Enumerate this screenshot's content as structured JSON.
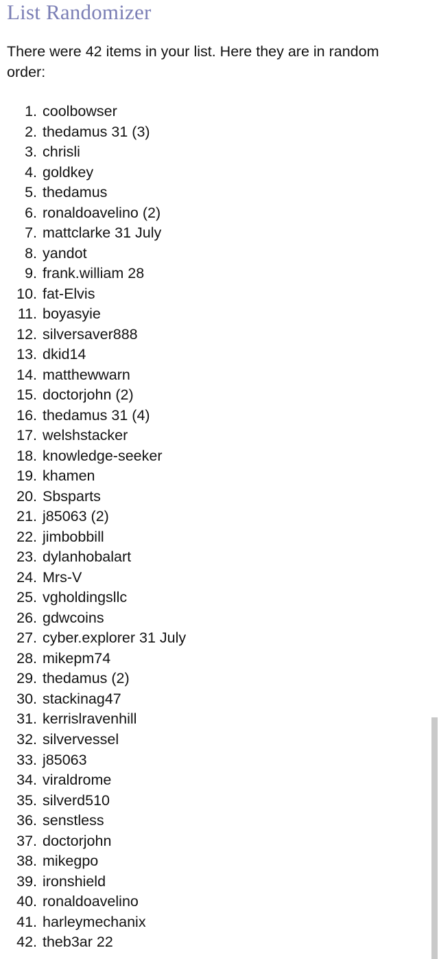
{
  "page": {
    "title": "List Randomizer",
    "intro": "There were 42 items in your list. Here they are in random order:",
    "item_count": 42,
    "background_color": "#ffffff",
    "title_color": "#7b7fb5",
    "text_color": "#111111"
  },
  "list": {
    "items": [
      {
        "index": "1.",
        "label": "coolbowser"
      },
      {
        "index": "2.",
        "label": "thedamus 31 (3)"
      },
      {
        "index": "3.",
        "label": "chrisli"
      },
      {
        "index": "4.",
        "label": "goldkey"
      },
      {
        "index": "5.",
        "label": "thedamus"
      },
      {
        "index": "6.",
        "label": "ronaldoavelino (2)"
      },
      {
        "index": "7.",
        "label": "mattclarke 31 July"
      },
      {
        "index": "8.",
        "label": "yandot"
      },
      {
        "index": "9.",
        "label": "frank.william 28"
      },
      {
        "index": "10.",
        "label": "fat-Elvis"
      },
      {
        "index": "11.",
        "label": "boyasyie"
      },
      {
        "index": "12.",
        "label": "silversaver888"
      },
      {
        "index": "13.",
        "label": "dkid14"
      },
      {
        "index": "14.",
        "label": "matthewwarn"
      },
      {
        "index": "15.",
        "label": "doctorjohn (2)"
      },
      {
        "index": "16.",
        "label": "thedamus 31 (4)"
      },
      {
        "index": "17.",
        "label": "welshstacker"
      },
      {
        "index": "18.",
        "label": "knowledge-seeker"
      },
      {
        "index": "19.",
        "label": "khamen"
      },
      {
        "index": "20.",
        "label": "Sbsparts"
      },
      {
        "index": "21.",
        "label": "j85063 (2)"
      },
      {
        "index": "22.",
        "label": "jimbobbill"
      },
      {
        "index": "23.",
        "label": "dylanhobalart"
      },
      {
        "index": "24.",
        "label": "Mrs-V"
      },
      {
        "index": "25.",
        "label": "vgholdingsllc"
      },
      {
        "index": "26.",
        "label": "gdwcoins"
      },
      {
        "index": "27.",
        "label": "cyber.explorer 31 July"
      },
      {
        "index": "28.",
        "label": "mikepm74"
      },
      {
        "index": "29.",
        "label": "thedamus (2)"
      },
      {
        "index": "30.",
        "label": "stackinag47"
      },
      {
        "index": "31.",
        "label": "kerrislravenhill"
      },
      {
        "index": "32.",
        "label": "silvervessel"
      },
      {
        "index": "33.",
        "label": "j85063"
      },
      {
        "index": "34.",
        "label": "viraldrome"
      },
      {
        "index": "35.",
        "label": "silverd510"
      },
      {
        "index": "36.",
        "label": "senstless"
      },
      {
        "index": "37.",
        "label": "doctorjohn"
      },
      {
        "index": "38.",
        "label": "mikegpo"
      },
      {
        "index": "39.",
        "label": "ironshield"
      },
      {
        "index": "40.",
        "label": "ronaldoavelino"
      },
      {
        "index": "41.",
        "label": "harleymechanix"
      },
      {
        "index": "42.",
        "label": "theb3ar 22"
      }
    ]
  },
  "scrollbar": {
    "thumb_color": "#c9c9c9"
  }
}
